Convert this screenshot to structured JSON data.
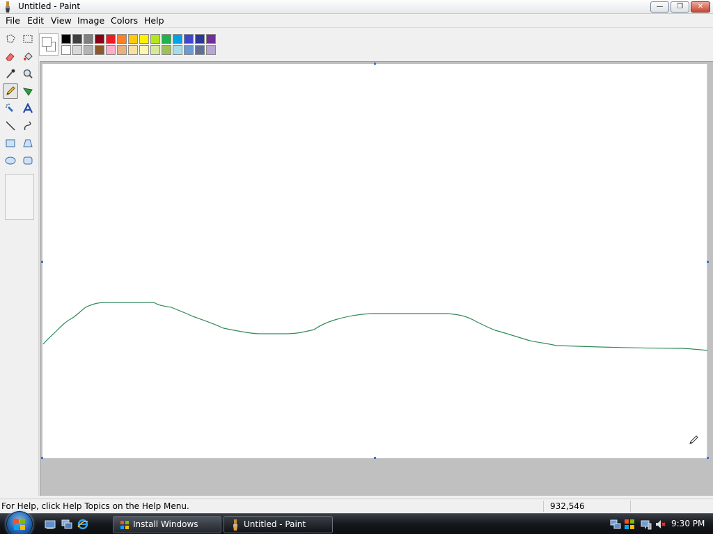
{
  "window": {
    "title": "Untitled - Paint",
    "icon": "paint-brush-icon",
    "controls": [
      "minimize-icon",
      "maximize-icon",
      "close-icon"
    ]
  },
  "menu": [
    "File",
    "Edit",
    "View",
    "Image",
    "Colors",
    "Help"
  ],
  "tools": [
    {
      "name": "free-form-select-icon"
    },
    {
      "name": "select-icon"
    },
    {
      "name": "eraser-icon"
    },
    {
      "name": "fill-with-color-icon"
    },
    {
      "name": "pick-color-icon"
    },
    {
      "name": "magnifier-icon"
    },
    {
      "name": "pencil-icon",
      "selected": true
    },
    {
      "name": "brush-icon"
    },
    {
      "name": "airbrush-icon"
    },
    {
      "name": "text-icon"
    },
    {
      "name": "line-icon"
    },
    {
      "name": "curve-icon"
    },
    {
      "name": "rectangle-icon"
    },
    {
      "name": "polygon-icon"
    },
    {
      "name": "ellipse-icon"
    },
    {
      "name": "rounded-rectangle-icon"
    }
  ],
  "palette": {
    "foreground": "#ffffff",
    "background": "#ffffff",
    "row1": [
      "#000000",
      "#404040",
      "#7f7f7f",
      "#880015",
      "#ed1c24",
      "#ff7f27",
      "#ffc90e",
      "#fff200",
      "#b5e61d",
      "#22b14c",
      "#00a2e8",
      "#3f48cc",
      "#2f3699",
      "#6f3198"
    ],
    "row2": [
      "#ffffff",
      "#d9d9d9",
      "#b4b4b4",
      "#8b5a2b",
      "#ffaec9",
      "#e8b07a",
      "#f7e0a0",
      "#fbf6b0",
      "#d8e89a",
      "#9fbf5a",
      "#a6dce8",
      "#6c9ad4",
      "#5f6f96",
      "#b8a6d4"
    ]
  },
  "drawing": {
    "stroke_color": "#2e8b57"
  },
  "status": {
    "help_text": "For Help, click Help Topics on the Help Menu.",
    "coordinates": "932,546"
  },
  "taskbar": {
    "start": "start-orb-icon",
    "quick_launch": [
      "show-desktop-icon",
      "switch-windows-icon",
      "internet-explorer-icon"
    ],
    "buttons": [
      {
        "label": "Install Windows",
        "icon": "install-windows-icon",
        "active": false
      },
      {
        "label": "Untitled - Paint",
        "icon": "paint-brush-icon",
        "active": true
      }
    ],
    "tray": [
      "network-icon",
      "security-icon",
      "display-icon",
      "volume-muted-icon"
    ],
    "clock": "9:30 PM"
  }
}
